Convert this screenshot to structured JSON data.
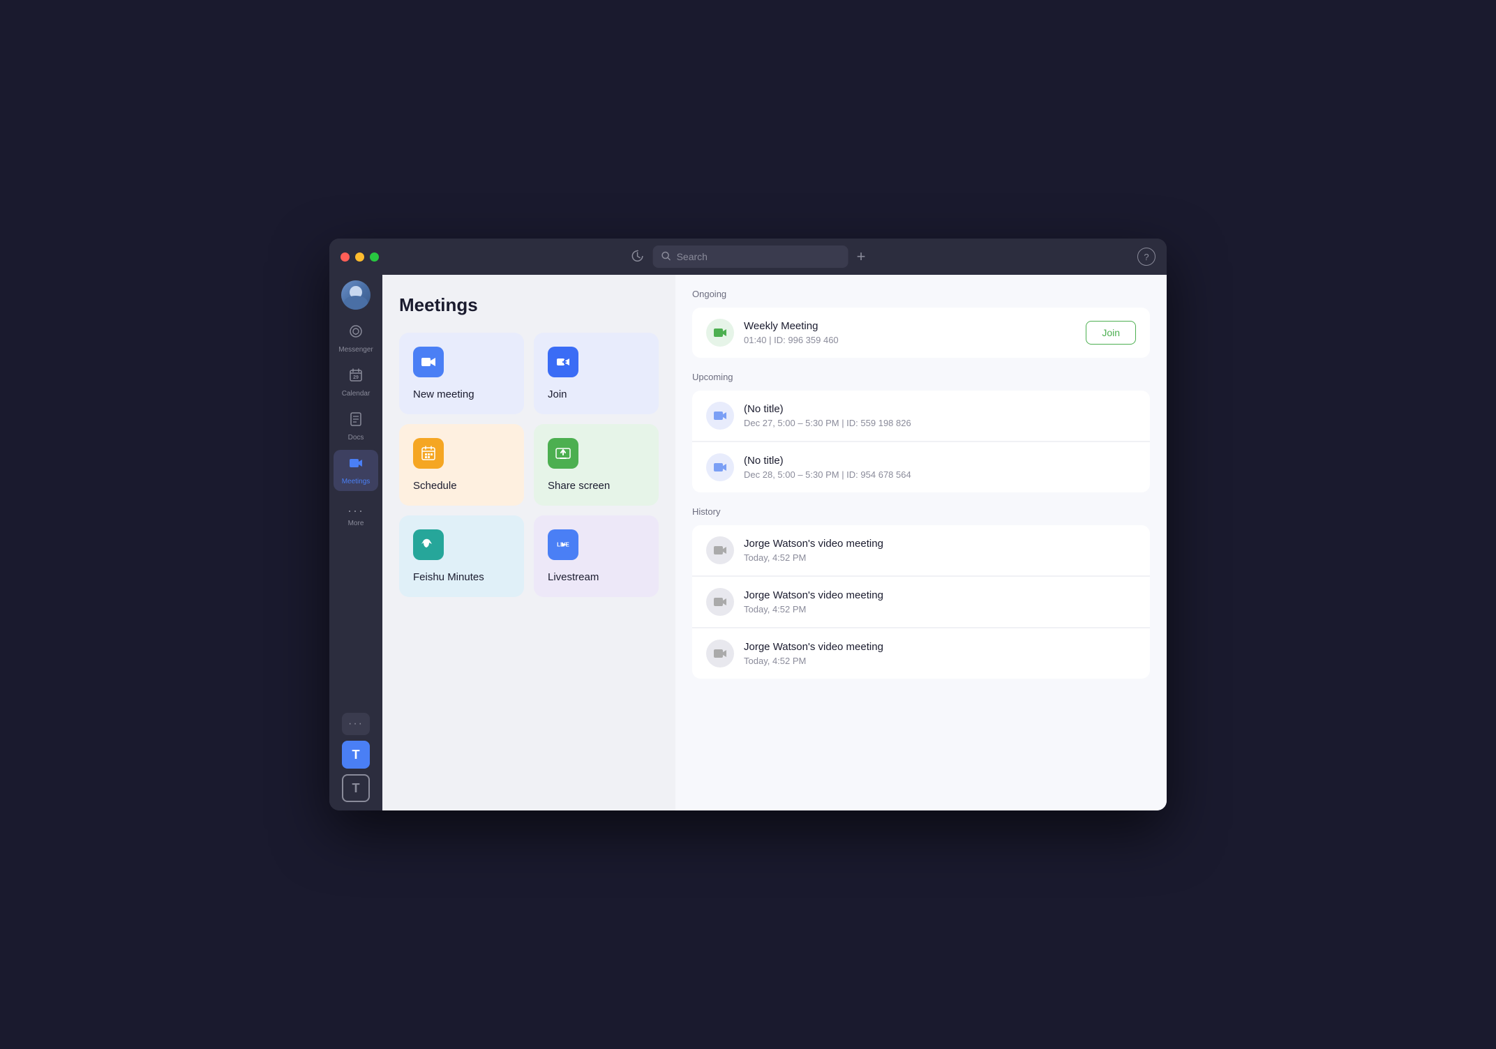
{
  "window": {
    "title": "Meetings"
  },
  "titlebar": {
    "traffic_lights": [
      "red",
      "yellow",
      "green"
    ],
    "history_icon": "↺",
    "search_placeholder": "Search",
    "add_icon": "+",
    "help_icon": "?"
  },
  "sidebar": {
    "items": [
      {
        "id": "messenger",
        "label": "Messenger",
        "icon": "💬"
      },
      {
        "id": "calendar",
        "label": "Calendar",
        "icon": "📅"
      },
      {
        "id": "docs",
        "label": "Docs",
        "icon": "📄"
      },
      {
        "id": "meetings",
        "label": "Meetings",
        "icon": "🔵",
        "active": true
      }
    ],
    "more_label": "More",
    "more_icon": "···",
    "dots_btn": "···",
    "t_blue": "T",
    "t_outline": "T"
  },
  "main": {
    "page_title": "Meetings",
    "actions": [
      {
        "id": "new-meeting",
        "label": "New meeting",
        "bg": "blue-bg",
        "icon_bg": "icon-blue",
        "icon": "📹"
      },
      {
        "id": "join",
        "label": "Join",
        "bg": "blue-bg",
        "icon_bg": "icon-blue2",
        "icon": "➕"
      },
      {
        "id": "schedule",
        "label": "Schedule",
        "bg": "orange-bg",
        "icon_bg": "icon-orange",
        "icon": "⊞"
      },
      {
        "id": "share-screen",
        "label": "Share screen",
        "bg": "green-bg",
        "icon_bg": "icon-green",
        "icon": "⬆"
      },
      {
        "id": "feishu-minutes",
        "label": "Feishu Minutes",
        "bg": "lightblue-bg",
        "icon_bg": "icon-teal",
        "icon": "≈"
      },
      {
        "id": "livestream",
        "label": "Livestream",
        "bg": "purple-bg",
        "icon_bg": "icon-blue",
        "icon": "▶"
      }
    ],
    "sections": {
      "ongoing": {
        "title": "Ongoing",
        "items": [
          {
            "title": "Weekly Meeting",
            "sub": "01:40  |  ID: 996 359 460",
            "has_join": true,
            "join_label": "Join",
            "avatar_type": "green"
          }
        ]
      },
      "upcoming": {
        "title": "Upcoming",
        "items": [
          {
            "title": "(No title)",
            "sub": "Dec 27, 5:00 – 5:30 PM  |  ID: 559 198 826",
            "avatar_type": "blue-light"
          },
          {
            "title": "(No title)",
            "sub": "Dec 28, 5:00 – 5:30 PM  |  ID: 954 678 564",
            "avatar_type": "blue-light"
          }
        ]
      },
      "history": {
        "title": "History",
        "items": [
          {
            "title": "Jorge Watson's video meeting",
            "sub": "Today, 4:52 PM",
            "avatar_type": "gray"
          },
          {
            "title": "Jorge Watson's video meeting",
            "sub": "Today, 4:52 PM",
            "avatar_type": "gray"
          },
          {
            "title": "Jorge Watson's video meeting",
            "sub": "Today, 4:52 PM",
            "avatar_type": "gray"
          }
        ]
      }
    }
  }
}
